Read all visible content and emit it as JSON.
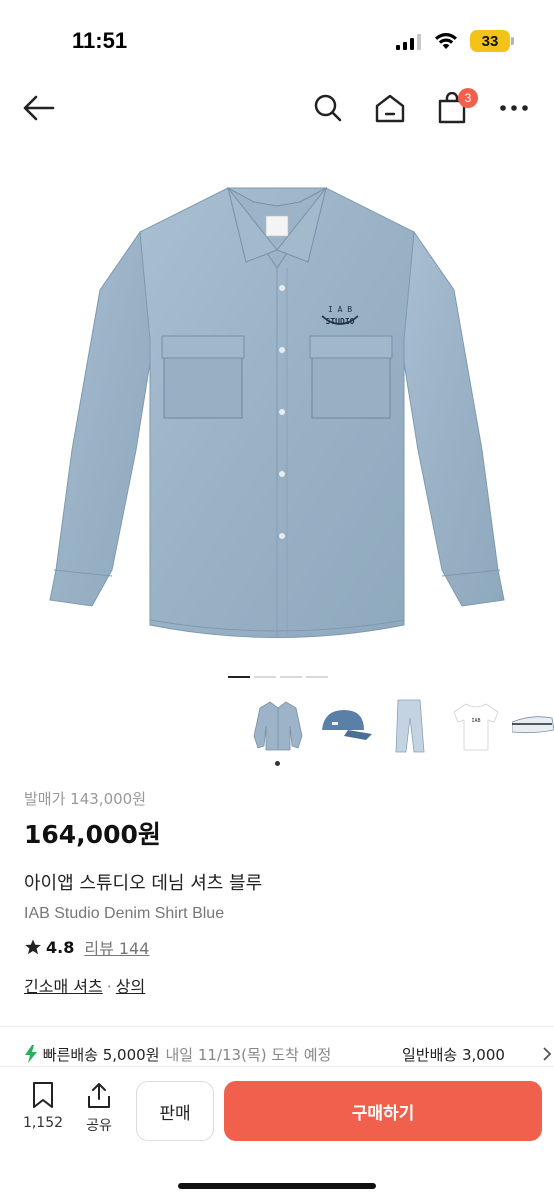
{
  "status_bar": {
    "time": "11:51",
    "battery": "33"
  },
  "nav": {
    "cart_count": "3"
  },
  "gallery": {
    "page_count": 4,
    "active_index": 0,
    "logo_text_top": "I A B",
    "logo_text_bottom": "STUDIO"
  },
  "product": {
    "original_price": "발매가 143,000원",
    "price": "164,000원",
    "name_ko": "아이앱 스튜디오 데님 셔츠 블루",
    "name_en": "IAB Studio Denim Shirt Blue",
    "rating": "4.8",
    "reviews": "리뷰 144",
    "category_1": "긴소매 셔츠",
    "category_sep": "·",
    "category_2": "상의"
  },
  "shipping": {
    "fast_label": "빠른배송 5,000원",
    "fast_arrival": "내일 11/13(목) 도착 예정",
    "normal_label": "일반배송 3,000"
  },
  "bottom_bar": {
    "bookmark_count": "1,152",
    "share_label": "공유",
    "sell_label": "판매",
    "buy_label": "구매하기"
  },
  "colors": {
    "accent": "#f0604d",
    "denim": "#9cb3c7",
    "battery": "#f4c319"
  }
}
